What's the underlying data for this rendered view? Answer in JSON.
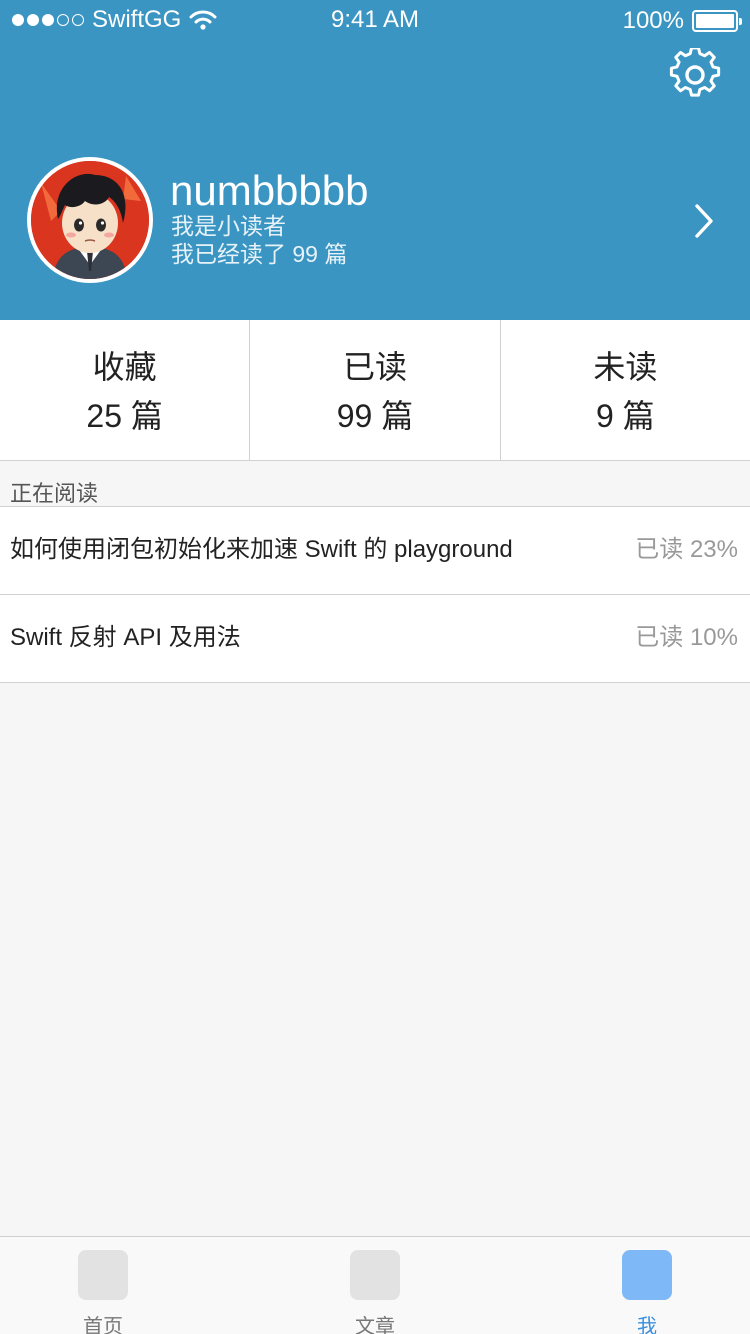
{
  "status_bar": {
    "carrier": "SwiftGG",
    "time": "9:41 AM",
    "battery": "100%",
    "signal_bars_filled": 3,
    "signal_bars_total": 5
  },
  "profile": {
    "username": "numbbbbb",
    "subtitle": "我是小读者",
    "read_count_text": "我已经读了 99 篇"
  },
  "stats": [
    {
      "label": "收藏",
      "value": "25 篇"
    },
    {
      "label": "已读",
      "value": "99 篇"
    },
    {
      "label": "未读",
      "value": "9 篇"
    }
  ],
  "reading_section": {
    "title": "正在阅读",
    "items": [
      {
        "title": "如何使用闭包初始化来加速 Swift 的 playground",
        "progress": "已读 23%"
      },
      {
        "title": "Swift 反射 API 及用法",
        "progress": "已读 10%"
      }
    ]
  },
  "tab_bar": {
    "items": [
      {
        "label": "首页",
        "active": false
      },
      {
        "label": "文章",
        "active": false
      },
      {
        "label": "我",
        "active": true
      }
    ]
  },
  "colors": {
    "header_bg": "#3a95c3",
    "active_tab": "#3a8fde",
    "active_tab_icon": "#7eb8f7"
  },
  "icons": {
    "settings": "gear-icon",
    "disclosure": "chevron-right-icon",
    "wifi": "wifi-icon",
    "battery": "battery-icon"
  }
}
